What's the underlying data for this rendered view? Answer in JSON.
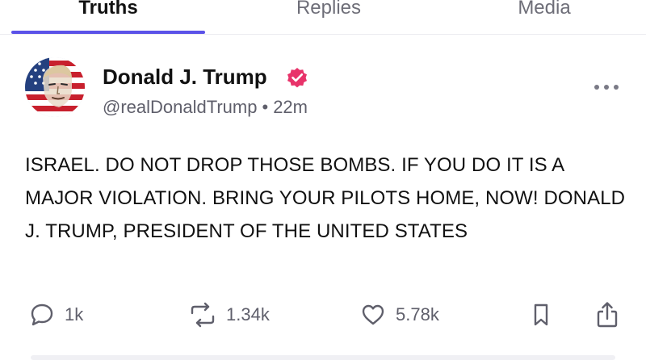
{
  "tabs": {
    "truths": "Truths",
    "replies": "Replies",
    "media": "Media"
  },
  "post": {
    "display_name": "Donald J. Trump",
    "handle": "@realDonaldTrump",
    "separator": "•",
    "time": "22m",
    "text": "ISRAEL. DO NOT DROP THOSE BOMBS. IF YOU DO IT IS A MAJOR VIOLATION. BRING YOUR PILOTS HOME, NOW! DONALD J. TRUMP, PRESIDENT OF THE UNITED STATES",
    "avatar_icon": "flag-portrait-avatar",
    "verified_icon": "verified-badge-icon"
  },
  "actions": {
    "replies_count": "1k",
    "retruths_count": "1.34k",
    "likes_count": "5.78k"
  },
  "colors": {
    "accent": "#5b52e8",
    "verified": "#e8336a",
    "secondary_text": "#5f5f6b"
  }
}
